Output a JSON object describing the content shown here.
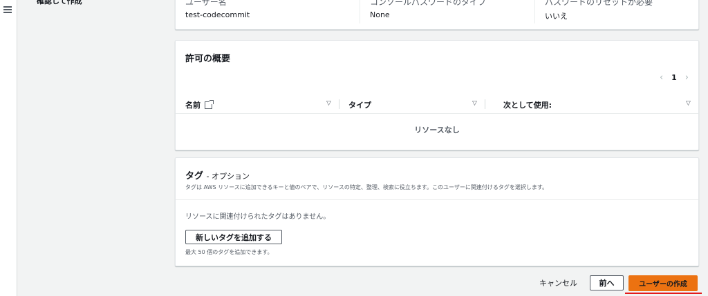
{
  "sidebar": {
    "step_label": "確認して作成"
  },
  "user_details": {
    "username_label": "ユーザー名",
    "username_value": "test-codecommit",
    "console_pw_label": "コンソールパスワードのタイプ",
    "console_pw_value": "None",
    "pw_reset_label": "パスワードのリセットが必要",
    "pw_reset_value": "いいえ"
  },
  "permissions": {
    "title": "許可の概要",
    "page": "1",
    "columns": [
      "名前",
      "タイプ",
      "次として使用:"
    ],
    "empty_text": "リソースなし"
  },
  "tags": {
    "title": "タグ",
    "title_suffix": "- オプション",
    "description": "タグは AWS リソースに追加できるキーと値のペアで、リソースの特定、整理、検索に役立ちます。このユーザーに関連付けるタグを選択します。",
    "no_tags_text": "リソースに関連付けられたタグはありません。",
    "add_button": "新しいタグを追加する",
    "limit_hint": "最大 50 個のタグを追加できます。"
  },
  "footer": {
    "cancel": "キャンセル",
    "previous": "前へ",
    "create": "ユーザーの作成"
  },
  "colors": {
    "primary": "#ec7211",
    "highlight": "#e31b1b"
  }
}
